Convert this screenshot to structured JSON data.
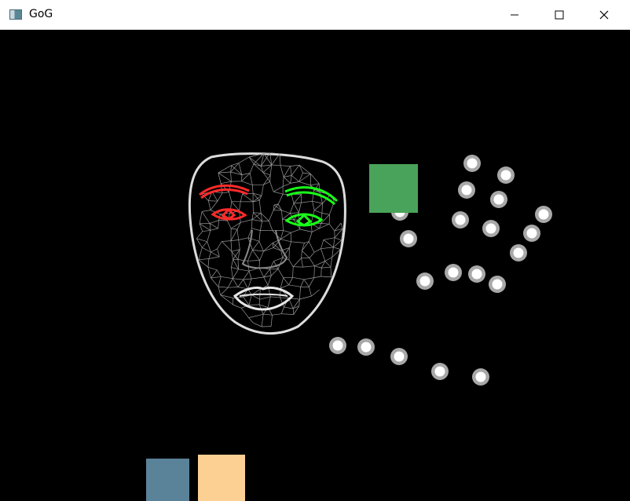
{
  "window": {
    "title": "GoG",
    "app_icon": "window-app-icon",
    "controls": [
      "minimize-icon",
      "maximize-icon",
      "close-icon"
    ]
  },
  "colors": {
    "background": "#000000",
    "mesh": "#d8d8d8",
    "left_features": "#ff2a2a",
    "right_features": "#19ff19",
    "green_square": "#4aa35a",
    "blue_square": "#5a8299",
    "peach_square": "#fcd093",
    "dot_fill": "#ffffff",
    "dot_ring": "#a8a8a8"
  }
}
